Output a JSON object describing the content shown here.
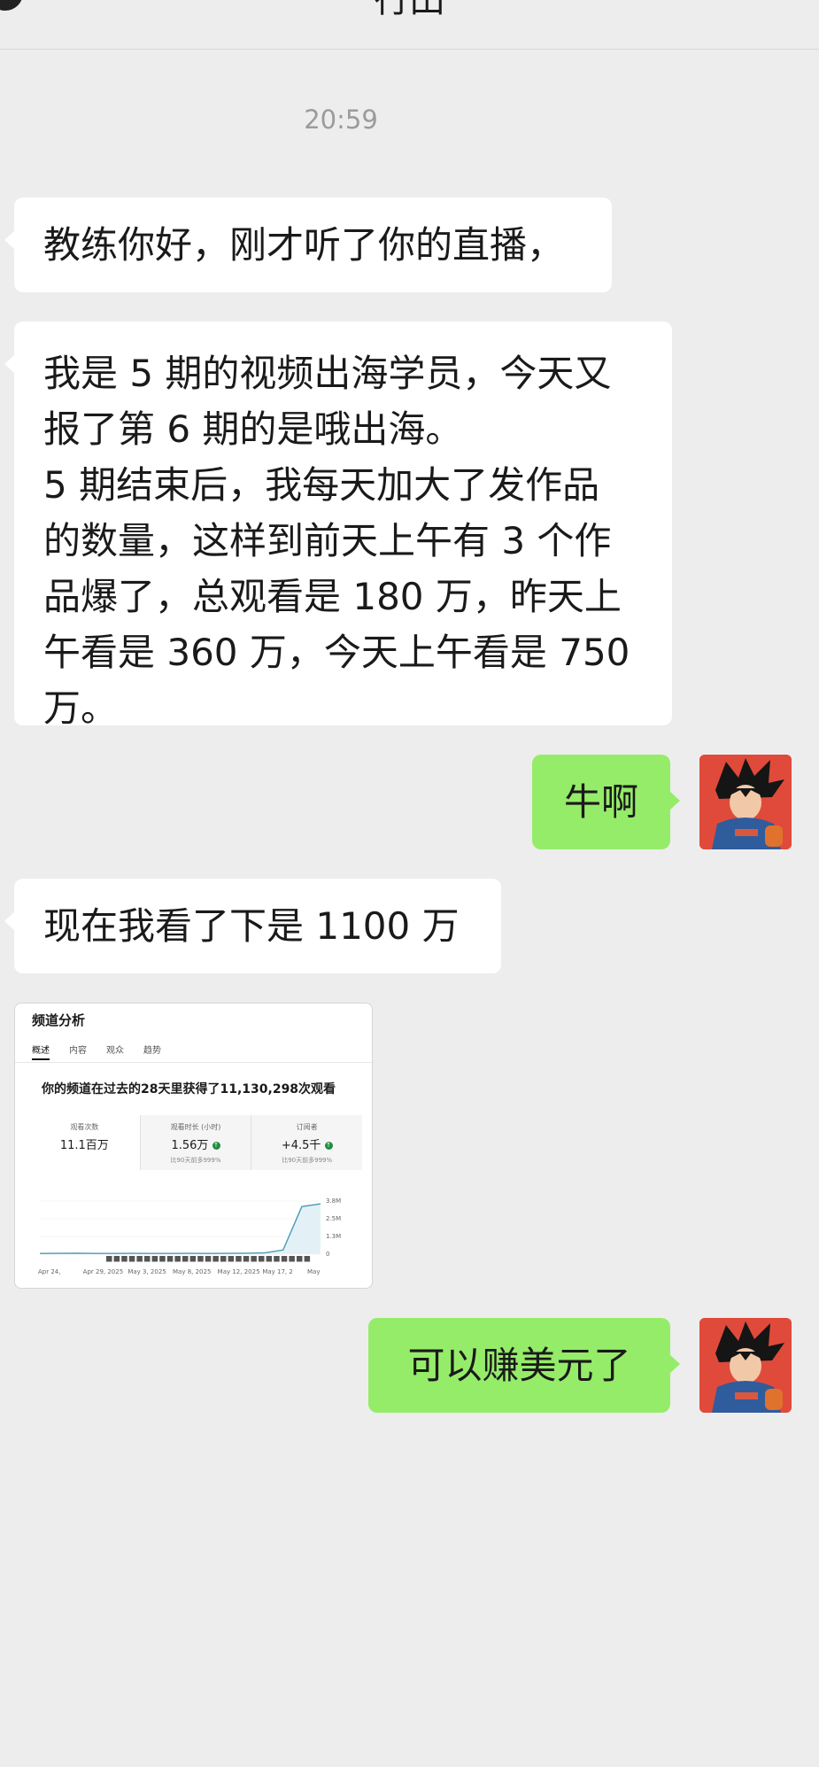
{
  "header": {
    "title": "行田"
  },
  "timestamp": "20:59",
  "messages": [
    {
      "side": "left",
      "text": "教练你好，刚才听了你的直播，"
    },
    {
      "side": "left",
      "text": "我是 5 期的视频出海学员，今天又\n报了第 6 期的是哦出海。\n5 期结束后，我每天加大了发作品\n的数量，这样到前天上午有 3 个作\n品爆了，总观看是 180 万，昨天上\n午看是 360 万，今天上午看是 750\n万。"
    },
    {
      "side": "right",
      "text": "牛啊"
    },
    {
      "side": "left",
      "text": "现在我看了下是 1100 万"
    },
    {
      "side": "right",
      "text": "可以赚美元了"
    }
  ],
  "analytics_card": {
    "title": "频道分析",
    "tabs": [
      "概述",
      "内容",
      "观众",
      "趋势"
    ],
    "active_tab": 0,
    "headline": "你的频道在过去的28天里获得了11,130,298次观看",
    "stats": [
      {
        "label": "观看次数",
        "value": "11.1百万",
        "note": "",
        "up": false
      },
      {
        "label": "观看时长 (小时)",
        "value": "1.56万",
        "note": "比90天前多999%",
        "up": true
      },
      {
        "label": "订阅者",
        "value": "+4.5千",
        "note": "比90天前多999%",
        "up": true
      }
    ],
    "chart_data": {
      "type": "line",
      "x": [
        "Apr 24,",
        "Apr 29, 2025",
        "May 3, 2025",
        "May 8, 2025",
        "May 12, 2025",
        "May 17, 2",
        "May"
      ],
      "y_ticks": [
        "3.8M",
        "2.5M",
        "1.3M",
        "0"
      ],
      "series": [
        {
          "values": [
            0.05,
            0.06,
            0.07,
            0.05,
            0.05,
            0.06,
            0.05,
            0.05,
            0.06,
            0.05,
            0.06,
            0.07,
            0.09,
            0.3,
            3.4,
            3.6
          ]
        }
      ],
      "ylim": [
        0,
        3.8
      ]
    }
  },
  "colors": {
    "background": "#ededed",
    "left_bubble": "#ffffff",
    "right_bubble": "#95ec69",
    "chart_line": "#4a9bb5"
  }
}
